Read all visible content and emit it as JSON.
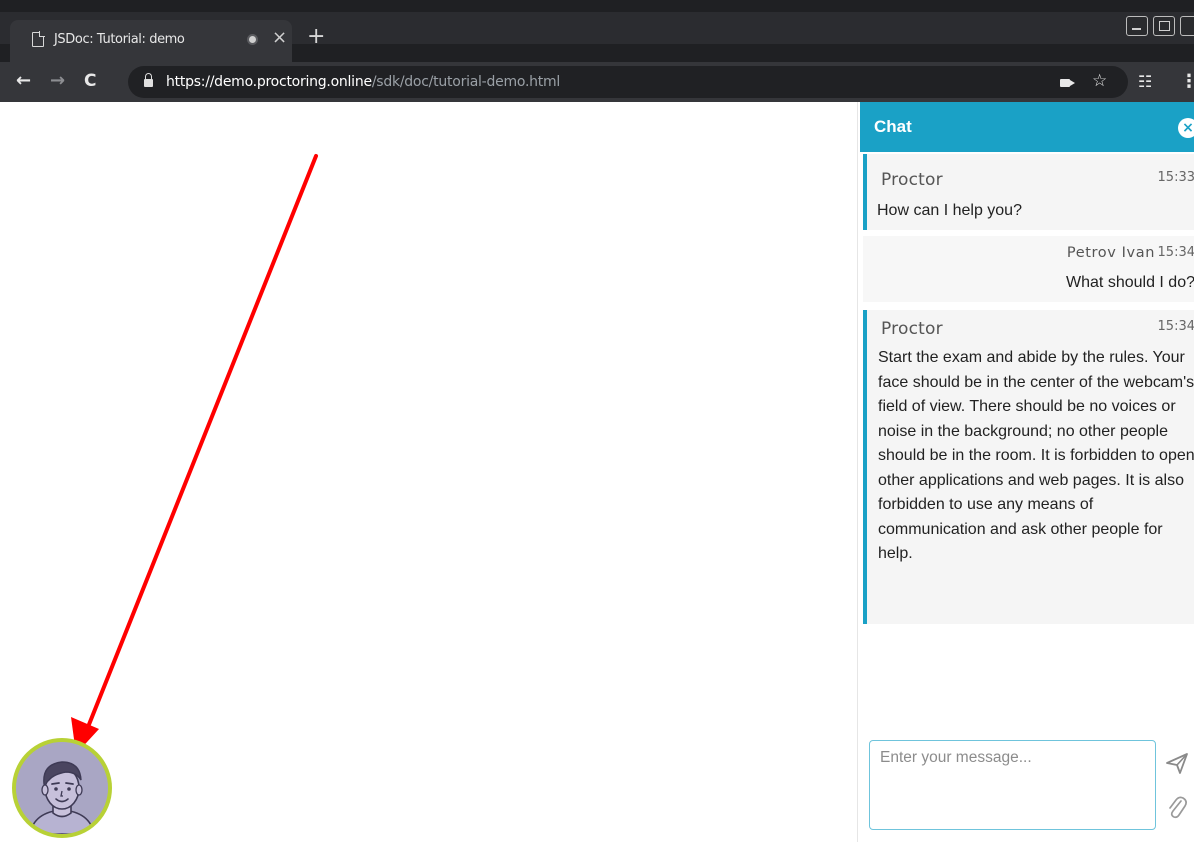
{
  "browser": {
    "tab_title": "JSDoc: Tutorial: demo",
    "tab_close": "×",
    "new_tab": "+",
    "url_host": "https://demo.proctoring.online",
    "url_path": "/sdk/doc/tutorial-demo.html"
  },
  "chat": {
    "title": "Chat",
    "close_icon": "×",
    "messages": [
      {
        "author": "Proctor",
        "time": "15:33",
        "text": "How can I help you?"
      },
      {
        "author": "Petrov Ivan",
        "time": "15:34",
        "text": "What should I do?"
      },
      {
        "author": "Proctor",
        "time": "15:34",
        "text": "Start the exam and abide by the rules. Your face should be in the center of the webcam's field of view. There should be no voices or noise in the background; no other people should be in the room. It is forbidden to open other applications and web pages. It is also forbidden to use any means of communication and ask other people for help."
      }
    ],
    "input": {
      "placeholder": "Enter your message...",
      "value": ""
    }
  },
  "colors": {
    "chat_header": "#1aa1c6",
    "proctor_accent": "#1aa1c6",
    "annotation_arrow": "#ff0000",
    "avatar_ring": "#b8d136"
  }
}
